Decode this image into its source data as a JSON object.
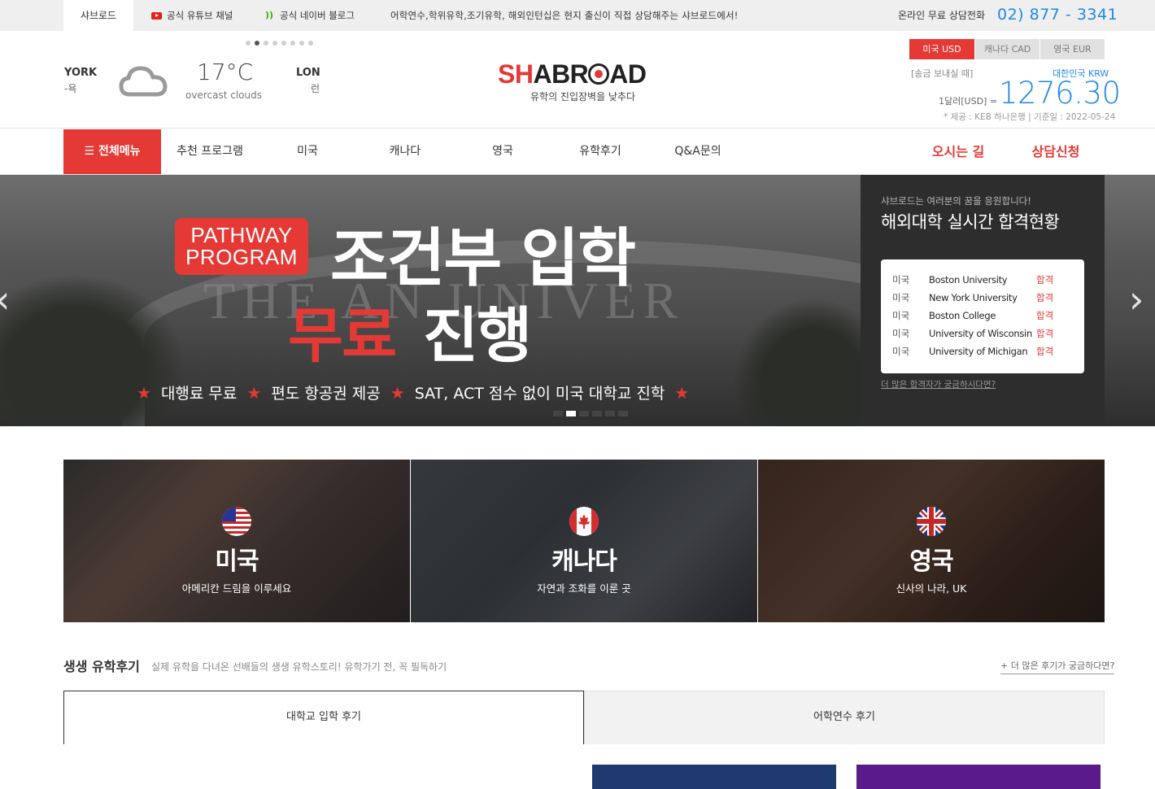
{
  "topbar": {
    "home_tab": "샤브로드",
    "youtube_label": "공식 유튜브 채널",
    "blog_label": "공식 네이버 블로그",
    "promo": "어학연수,학위유학,조기유학, 해외인턴십은 현지 출신이 직접 상담해주는 샤브로드에서!",
    "phone_label": "온라인 무료 상담전화",
    "phone": "02) 877 - 3341"
  },
  "weather": {
    "city1": "YORK",
    "city1_kr": "-욕",
    "temp": "17°C",
    "desc": "overcast clouds",
    "city2": "LON",
    "city2_kr": "런"
  },
  "logo": {
    "sh": "SH",
    "abr": "ABR",
    "ad": "AD",
    "tagline": "유학의 진입장벽을 낮추다"
  },
  "currency": {
    "tabs": [
      "미국 USD",
      "캐나다 CAD",
      "영국 EUR"
    ],
    "send_label": "[송금 보내실 때]",
    "krw_label": "대한민국 KRW",
    "rate_prefix": "1달러[USD] =",
    "rate": "1276.30",
    "note": "* 제공 : KEB 하나은행 | 기준일 : 2022-05-24"
  },
  "nav": {
    "all_menu": "☰ 전체메뉴",
    "items": [
      "추천 프로그램",
      "미국",
      "캐나다",
      "영국",
      "유학후기",
      "Q&A문의"
    ],
    "directions": "오시는 길",
    "consult": "상담신청"
  },
  "hero": {
    "bg_text": "THE      AN UNIVER",
    "badge_line1": "PATHWAY",
    "badge_line2": "PROGRAM",
    "title1": "조건부 입학",
    "title2a": "무료",
    "title2b": "진행",
    "bullets": [
      "대행료 무료",
      "편도 항공권 제공",
      "SAT, ACT 점수 없이 미국 대학교 진학"
    ],
    "star": "★",
    "prev": "‹",
    "next": "›"
  },
  "admissions": {
    "subtitle": "샤브로드는 여러분의 꿈을 응원합니다!",
    "title": "해외대학 실시간 합격현황",
    "rows": [
      {
        "country": "미국",
        "school": "Boston University",
        "status": "합격"
      },
      {
        "country": "미국",
        "school": "New York University",
        "status": "합격"
      },
      {
        "country": "미국",
        "school": "Boston College",
        "status": "합격"
      },
      {
        "country": "미국",
        "school": "University of Wisconsin",
        "status": "합격"
      },
      {
        "country": "미국",
        "school": "University of Michigan",
        "status": "합격"
      }
    ],
    "more": "더 많은 합격자가 궁금하시다면?"
  },
  "cards": [
    {
      "name": "미국",
      "desc": "아메리칸 드림을 이루세요"
    },
    {
      "name": "캐나다",
      "desc": "자연과 조화를 이룬 곳"
    },
    {
      "name": "영국",
      "desc": "신사의 나라, UK"
    }
  ],
  "reviews": {
    "title": "생생 유학후기",
    "subtitle": "실제 유학을 다녀온 선배들의 생생 유학스토리! 유학가기 전, 꼭 필독하기",
    "more": "+ 더 많은 후기가 궁금하다면?",
    "tabs": [
      "대학교 입학 후기",
      "어학연수 후기"
    ]
  },
  "colors": {
    "brand_red": "#e53935",
    "accent_blue": "#1e88e5",
    "panel_dark": "#2d2d2d"
  }
}
